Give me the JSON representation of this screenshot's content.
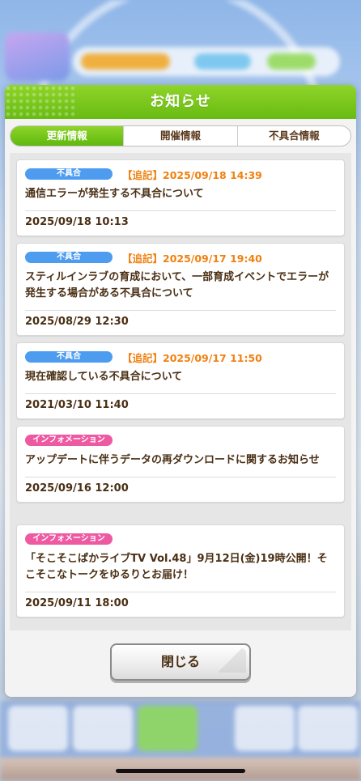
{
  "dialog": {
    "title": "お知らせ",
    "tabs": [
      {
        "label": "更新情報",
        "active": true
      },
      {
        "label": "開催情報",
        "active": false
      },
      {
        "label": "不具合情報",
        "active": false
      }
    ],
    "notices": [
      {
        "category": "不具合",
        "category_type": "bug",
        "update_note": "【追記】2025/09/18 14:39",
        "title": "通信エラーが発生する不具合について",
        "date": "2025/09/18 10:13"
      },
      {
        "category": "不具合",
        "category_type": "bug",
        "update_note": "【追記】2025/09/17 19:40",
        "title": "スティルインラブの育成において、一部育成イベントでエラーが発生する場合がある不具合について",
        "date": "2025/08/29 12:30"
      },
      {
        "category": "不具合",
        "category_type": "bug",
        "update_note": "【追記】2025/09/17 11:50",
        "title": "現在確認している不具合について",
        "date": "2021/03/10 11:40"
      },
      {
        "category": "インフォメーション",
        "category_type": "info",
        "update_note": "",
        "title": "アップデートに伴うデータの再ダウンロードに関するお知らせ",
        "date": "2025/09/16 12:00"
      },
      {
        "category": "インフォメーション",
        "category_type": "info",
        "update_note": "",
        "title": "「そこそこぱかライブTV Vol.48」9月12日(金)19時公開！そこそこなトークをゆるりとお届け！",
        "date": "2025/09/11 18:00"
      }
    ],
    "close_label": "閉じる"
  },
  "colors": {
    "header_green": "#68bb12",
    "bug_badge": "#4d9cf0",
    "info_badge": "#ee5aa2",
    "update_note": "#f08010",
    "text_brown": "#4a2f14"
  }
}
